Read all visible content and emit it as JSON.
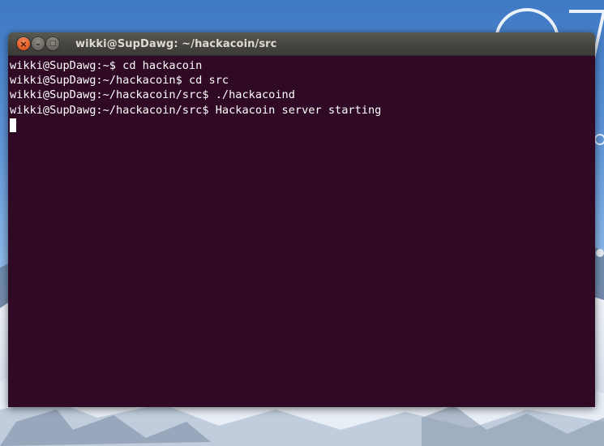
{
  "window": {
    "title": "wikki@SupDawg: ~/hackacoin/src",
    "close_glyph": "×",
    "minimize_glyph": "–",
    "maximize_glyph": "□"
  },
  "terminal": {
    "lines": [
      "wikki@SupDawg:~$ cd hackacoin",
      "wikki@SupDawg:~/hackacoin$ cd src",
      "wikki@SupDawg:~/hackacoin/src$ ./hackacoind",
      "wikki@SupDawg:~/hackacoin/src$ Hackacoin server starting"
    ],
    "background_color": "#300a24",
    "text_color": "#ffffff"
  },
  "colors": {
    "close_button": "#e8622b",
    "titlebar": "#3c3b37"
  }
}
